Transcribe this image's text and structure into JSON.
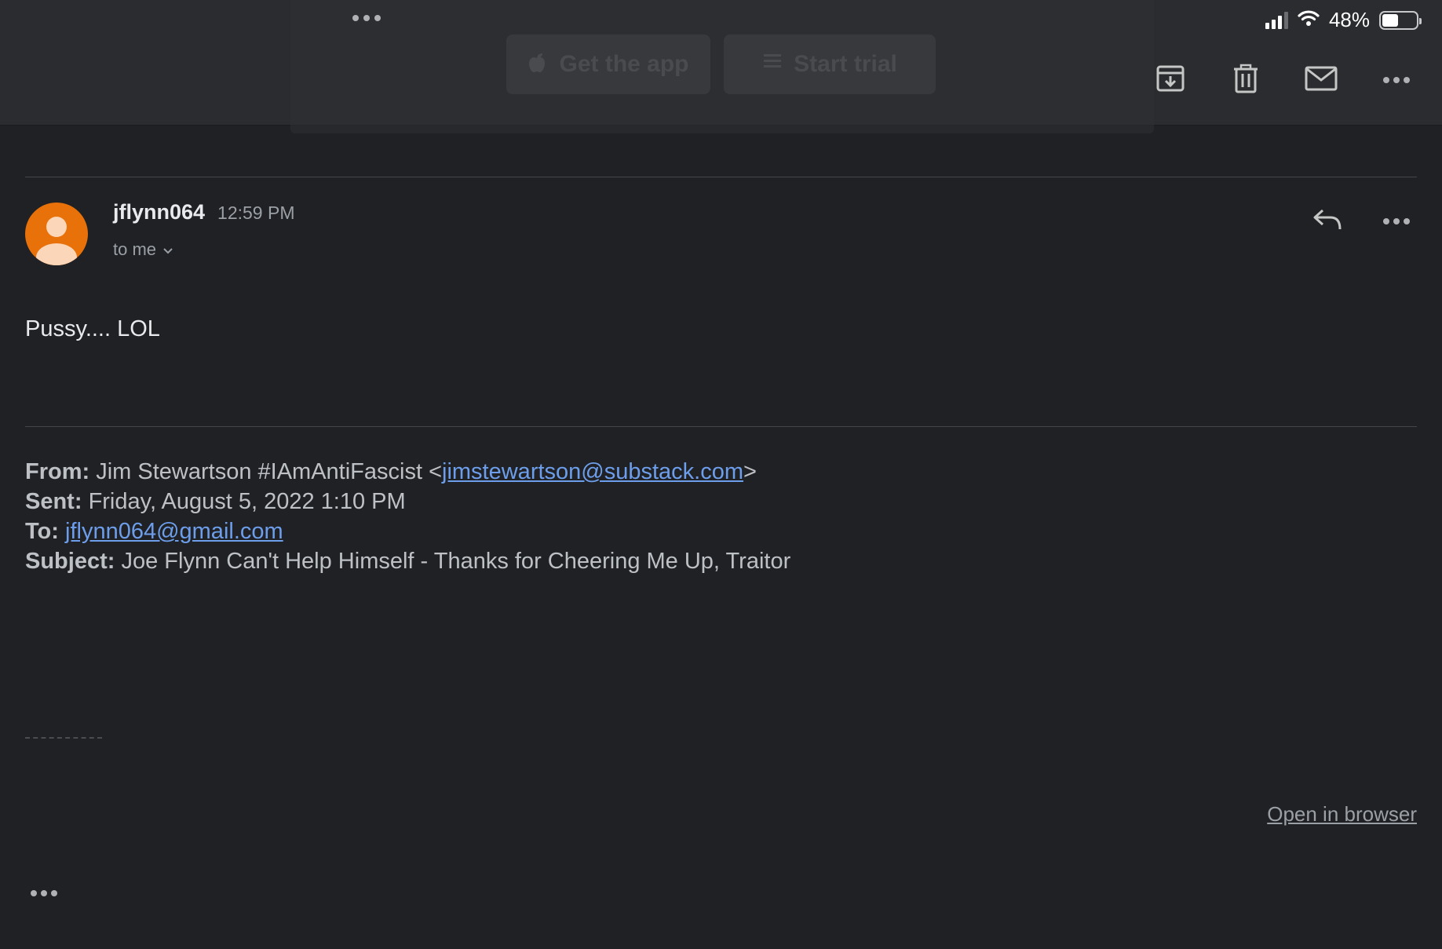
{
  "banner": {
    "get_app_label": "Get the app",
    "start_trial_label": "Start trial"
  },
  "status_bar": {
    "battery_text": "48%",
    "battery_level": 0.48
  },
  "message": {
    "sender_name": "jflynn064",
    "time": "12:59 PM",
    "recipient": "to me",
    "body": "Pussy.... LOL"
  },
  "quoted": {
    "from_label": "From:",
    "from_name": "Jim Stewartson #IAmAntiFascist <",
    "from_email": "jimstewartson@substack.com",
    "from_close": ">",
    "sent_label": "Sent:",
    "sent_value": "Friday, August 5, 2022 1:10 PM",
    "to_label": "To:",
    "to_email": "jflynn064@gmail.com",
    "subject_label": "Subject:",
    "subject_value": "Joe Flynn Can't Help Himself - Thanks for Cheering Me Up, Traitor"
  },
  "footer": {
    "open_in_browser": "Open in browser"
  },
  "icons": {
    "archive": "archive-icon",
    "delete": "trash-icon",
    "mark_unread": "mail-icon",
    "more": "more-icon",
    "reply": "reply-icon",
    "avatar": "person-icon"
  },
  "colors": {
    "background": "#202124",
    "avatar": "#e8710a",
    "link": "#6d9eeb"
  }
}
